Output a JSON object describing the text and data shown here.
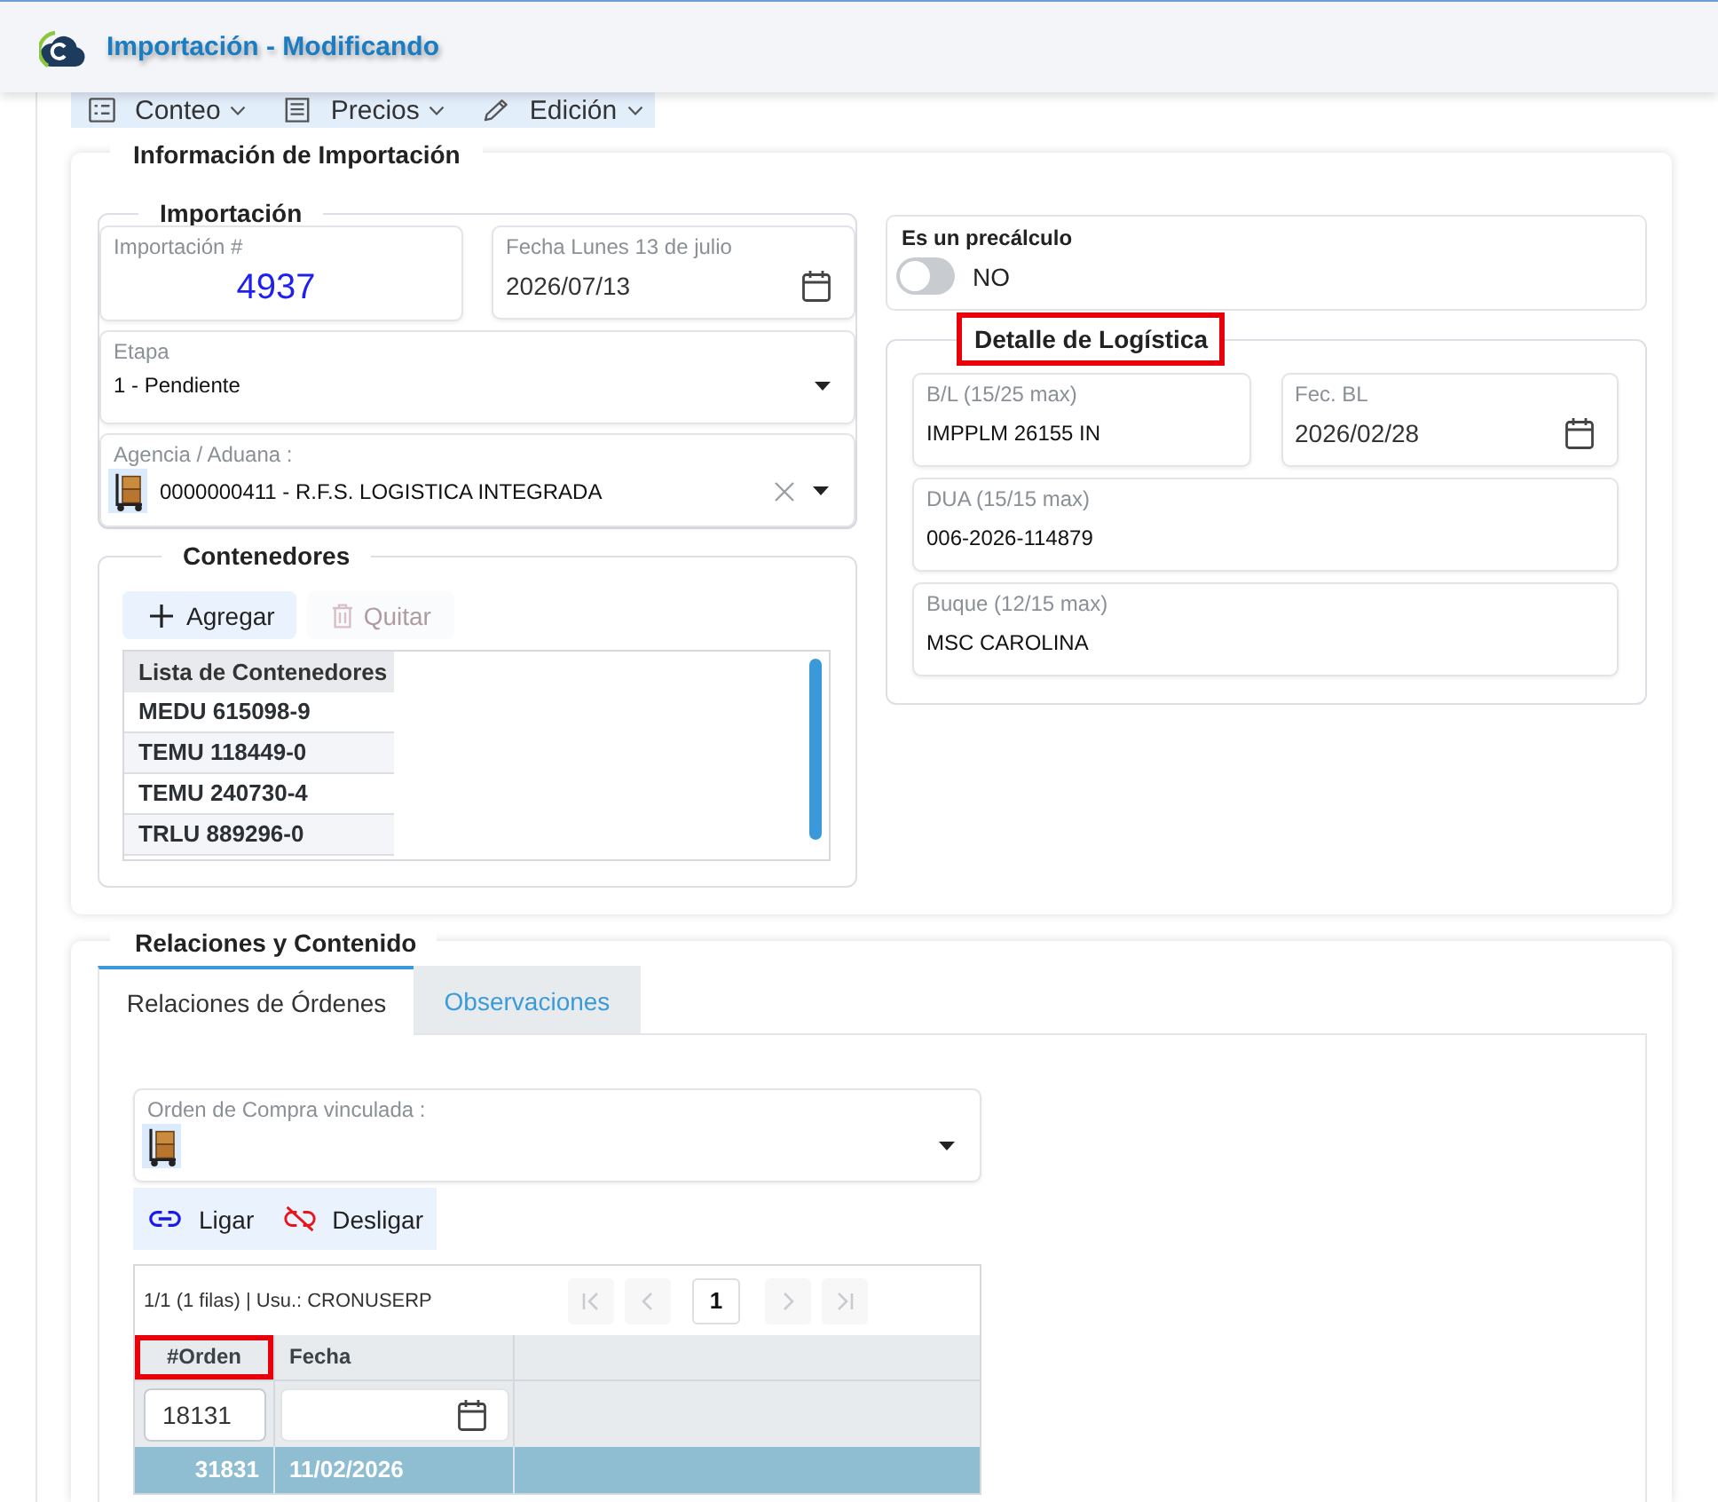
{
  "header": {
    "title": "Importación - Modificando"
  },
  "toolbar": [
    {
      "label": "Conteo"
    },
    {
      "label": "Precios"
    },
    {
      "label": "Edición"
    }
  ],
  "info_card": {
    "title": "Información de Importación",
    "importacion": {
      "legend": "Importación",
      "highlighted": false,
      "rows": [
        [
          {
            "kind": "number",
            "label": "Importación #",
            "value": "4937"
          },
          {
            "kind": "date",
            "label": "Fecha Lunes 13 de julio",
            "value": "2026/07/13"
          }
        ],
        [
          {
            "kind": "select",
            "label": "Etapa",
            "value": "1 - Pendiente"
          }
        ],
        [
          {
            "kind": "lookup",
            "label": "Agencia / Aduana :",
            "value": "0000000411 - R.F.S. LOGISTICA INTEGRADA"
          }
        ]
      ]
    },
    "contenedores": {
      "legend": "Contenedores",
      "highlighted": false,
      "buttons": [
        {
          "label": "Agregar",
          "disabled": false
        },
        {
          "label": "Quitar",
          "disabled": true
        }
      ],
      "list": {
        "column": "Lista de Contenedores",
        "rows": [
          "MEDU 615098-9",
          "TEMU 118449-0",
          "TEMU 240730-4",
          "TRLU 889296-0"
        ]
      }
    },
    "precalculo": {
      "label": "Es un precálculo",
      "on": false,
      "state_text": "NO"
    },
    "logistica": {
      "legend": "Detalle de Logística",
      "highlighted": true,
      "rows": [
        [
          {
            "kind": "text",
            "label": "B/L (15/25 max)",
            "value": "IMPPLM 26155 IN"
          },
          {
            "kind": "date",
            "label": "Fec. BL",
            "value": "2026/02/28"
          }
        ],
        [
          {
            "kind": "text",
            "label": "DUA (15/15 max)",
            "value": "006-2026-114879"
          }
        ],
        [
          {
            "kind": "text",
            "label": "Buque (12/15 max)",
            "value": "MSC CAROLINA"
          }
        ]
      ]
    }
  },
  "relaciones_card": {
    "title": "Relaciones y Contenido",
    "tabs": [
      {
        "label": "Relaciones de Órdenes",
        "selected": true
      },
      {
        "label": "Observaciones",
        "selected": false
      }
    ],
    "orden_compra": {
      "kind": "lookup",
      "label": "Orden de Compra vinculada :"
    },
    "actions": [
      {
        "label": "Ligar"
      },
      {
        "label": "Desligar"
      }
    ],
    "grid": {
      "info": "1/1 (1 filas) | Usu.: CRONUSERP",
      "pager": {
        "page": "1",
        "at_first": true,
        "at_last": true
      },
      "columns": [
        {
          "label": "#Orden",
          "kind": "text",
          "highlighted": true,
          "filter": "18131"
        },
        {
          "label": "Fecha",
          "kind": "date",
          "highlighted": false
        }
      ],
      "rows": [
        {
          "cells": [
            "31831",
            "11/02/2026"
          ],
          "selected": true
        }
      ]
    }
  }
}
